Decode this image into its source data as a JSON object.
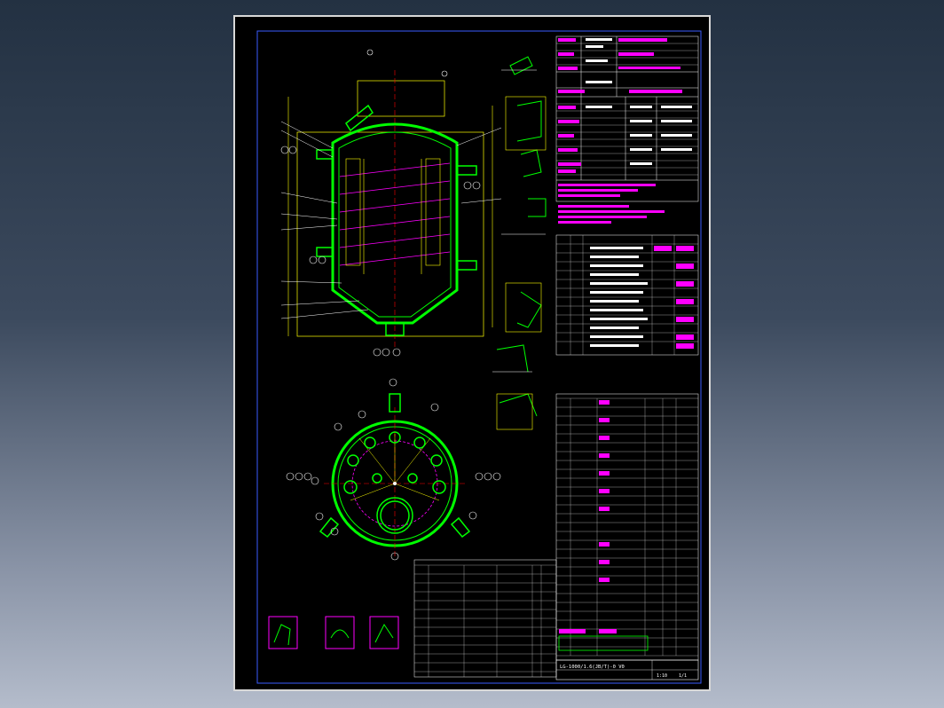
{
  "sheet": {
    "title_block": {
      "drawing_no": "LG-1000/1.6(JB/T)-0 V0",
      "scale_label": "1:10",
      "sheet_label": "1/1"
    },
    "section_labels": [
      "A-A",
      "B-B",
      "C-C",
      "I",
      "II",
      "III"
    ],
    "vessel_callouts": [
      "1",
      "2",
      "3",
      "4",
      "5",
      "6",
      "7",
      "8",
      "9",
      "10",
      "11",
      "12",
      "13",
      "14"
    ],
    "nozzle_callouts": [
      "N1",
      "N2",
      "N3",
      "N4",
      "N5",
      "N6",
      "N7",
      "N8",
      "N9",
      "N10",
      "N11",
      "N12"
    ]
  },
  "colors": {
    "vessel": "#00ff00",
    "dimension": "#ffff00",
    "table": "#ffffff",
    "highlight": "#ff00ff",
    "centerline": "#ff0000",
    "detail": "#00ffff"
  }
}
